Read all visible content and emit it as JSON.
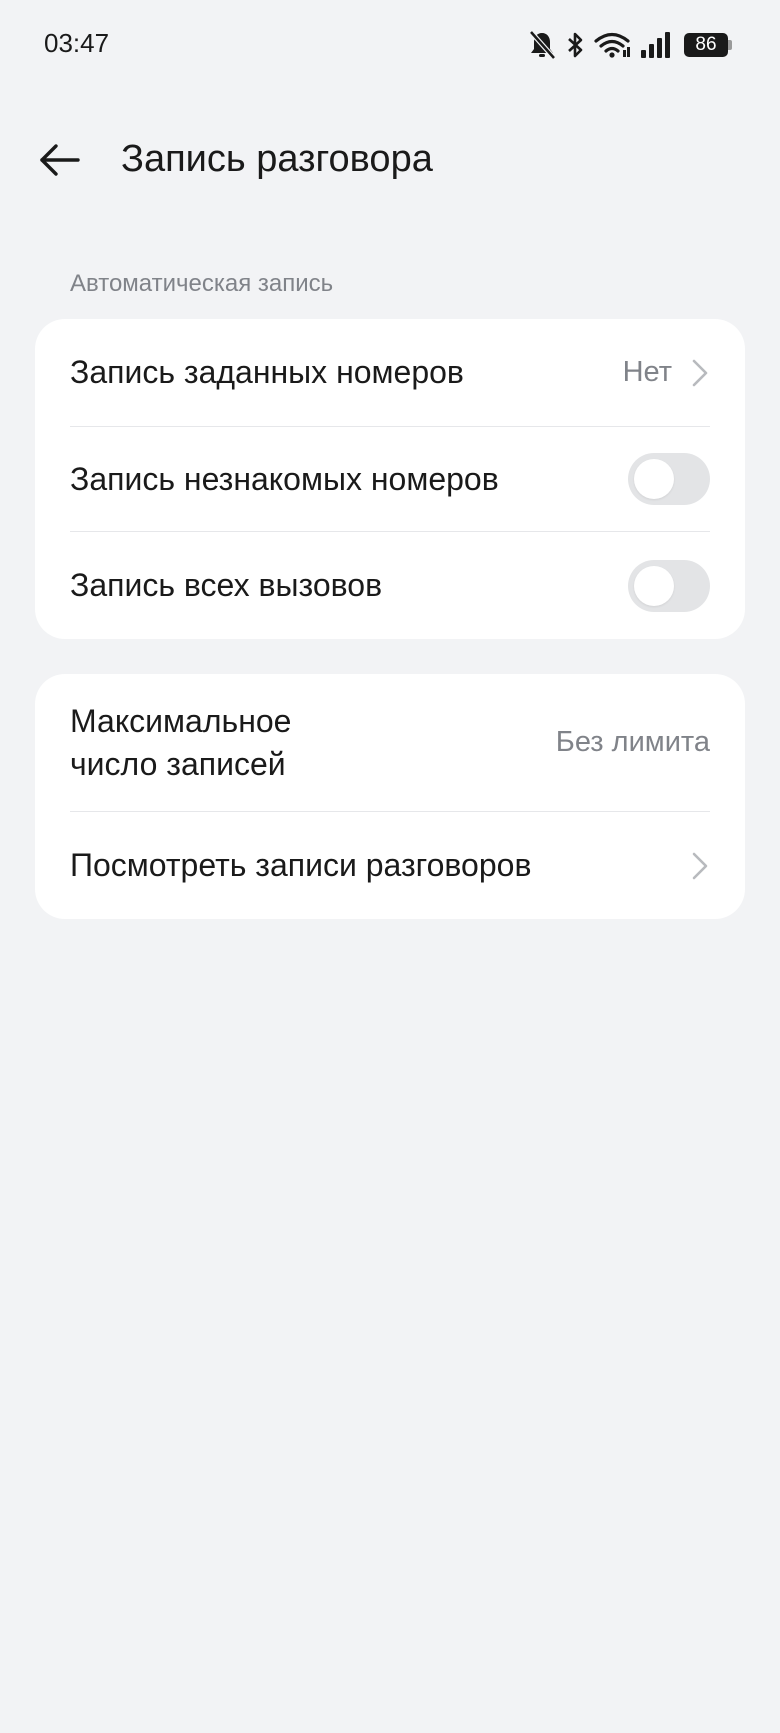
{
  "status_bar": {
    "time": "03:47",
    "battery": "86",
    "icons": [
      "mute-bell-icon",
      "bluetooth-icon",
      "wifi-icon",
      "signal-icon",
      "battery-icon"
    ]
  },
  "header": {
    "title": "Запись разговора",
    "back_icon": "arrow-left-icon"
  },
  "sections": {
    "auto_record_label": "Автоматическая запись"
  },
  "auto_record": {
    "specified_numbers": {
      "label": "Запись заданных номеров",
      "value": "Нет"
    },
    "unknown_numbers": {
      "label": "Запись незнакомых номеров",
      "enabled": false
    },
    "all_calls": {
      "label": "Запись всех вызовов",
      "enabled": false
    }
  },
  "storage": {
    "max_records": {
      "label_line1": "Максимальное",
      "label_line2": "число записей",
      "value": "Без лимита"
    },
    "view_records": {
      "label": "Посмотреть записи разговоров"
    }
  },
  "colors": {
    "background": "#f2f3f5",
    "card": "#ffffff",
    "secondary_text": "#808389",
    "toggle_off": "#e3e4e6"
  }
}
